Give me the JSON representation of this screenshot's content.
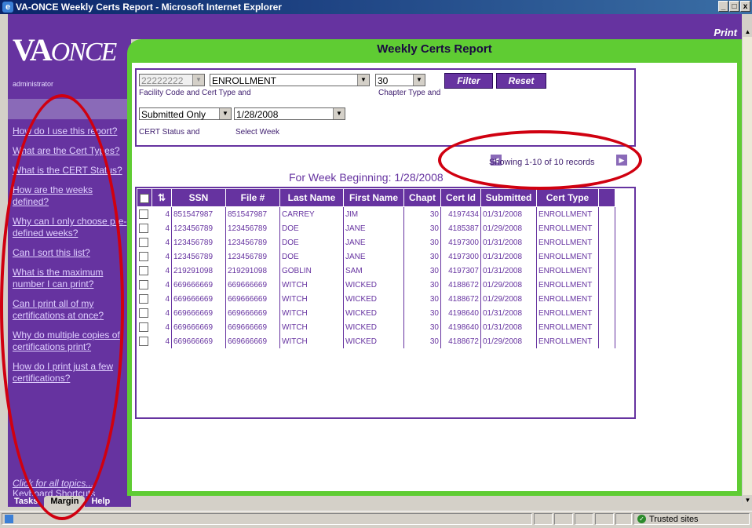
{
  "window": {
    "title": "VA-ONCE Weekly Certs Report - Microsoft Internet Explorer",
    "controls": [
      "_",
      "□",
      "x"
    ]
  },
  "sidebar": {
    "logo": {
      "main": "VA",
      "italic": "ONCE"
    },
    "role": "administrator",
    "help_links": [
      "How do I use this report?",
      "What are the Cert Types?",
      "What is the CERT Status?",
      "How are the weeks defined?",
      "Why can I only choose pre-defined weeks?",
      "Can I sort this list?",
      "What is the maximum number I can print?",
      "Can I print all of my certifications at once?",
      "Why do multiple copies of certifications print?",
      "How do I print just a few certifications?"
    ],
    "all_topics": "Click for all topics...",
    "shortcuts": "Keyboard Shortcuts",
    "tabs": [
      "Tasks",
      "Margin",
      "Help"
    ]
  },
  "header": {
    "print": "Print"
  },
  "page": {
    "title": "Weekly Certs Report"
  },
  "filters": {
    "facility_code": "22222222",
    "cert_type": "ENROLLMENT",
    "chapter": "30",
    "label_facility": "Facility Code and Cert Type and",
    "label_chapter": "Chapter Type and",
    "cert_status": "Submitted Only",
    "week": "1/28/2008",
    "label_status": "CERT Status and",
    "label_week": "Select Week",
    "filter_btn": "Filter",
    "reset_btn": "Reset"
  },
  "pager": {
    "text": "Showing 1-10 of 10 records"
  },
  "week_heading": "For Week Beginning: 1/28/2008",
  "grid": {
    "columns": [
      "",
      "",
      "SSN",
      "File #",
      "Last Name",
      "First Name",
      "Chapt",
      "Cert Id",
      "Submitted",
      "Cert Type"
    ],
    "rows": [
      [
        "4",
        "851547987",
        "851547987",
        "CARREY",
        "JIM",
        "30",
        "4197434",
        "01/31/2008",
        "ENROLLMENT"
      ],
      [
        "4",
        "123456789",
        "123456789",
        "DOE",
        "JANE",
        "30",
        "4185387",
        "01/29/2008",
        "ENROLLMENT"
      ],
      [
        "4",
        "123456789",
        "123456789",
        "DOE",
        "JANE",
        "30",
        "4197300",
        "01/31/2008",
        "ENROLLMENT"
      ],
      [
        "4",
        "123456789",
        "123456789",
        "DOE",
        "JANE",
        "30",
        "4197300",
        "01/31/2008",
        "ENROLLMENT"
      ],
      [
        "4",
        "219291098",
        "219291098",
        "GOBLIN",
        "SAM",
        "30",
        "4197307",
        "01/31/2008",
        "ENROLLMENT"
      ],
      [
        "4",
        "669666669",
        "669666669",
        "WITCH",
        "WICKED",
        "30",
        "4188672",
        "01/29/2008",
        "ENROLLMENT"
      ],
      [
        "4",
        "669666669",
        "669666669",
        "WITCH",
        "WICKED",
        "30",
        "4188672",
        "01/29/2008",
        "ENROLLMENT"
      ],
      [
        "4",
        "669666669",
        "669666669",
        "WITCH",
        "WICKED",
        "30",
        "4198640",
        "01/31/2008",
        "ENROLLMENT"
      ],
      [
        "4",
        "669666669",
        "669666669",
        "WITCH",
        "WICKED",
        "30",
        "4198640",
        "01/31/2008",
        "ENROLLMENT"
      ],
      [
        "4",
        "669666669",
        "669666669",
        "WITCH",
        "WICKED",
        "30",
        "4188672",
        "01/29/2008",
        "ENROLLMENT"
      ]
    ]
  },
  "statusbar": {
    "zone": "Trusted sites"
  },
  "colors": {
    "purple": "#6633a0",
    "green": "#5fcc33",
    "annotation_red": "#d00010"
  }
}
